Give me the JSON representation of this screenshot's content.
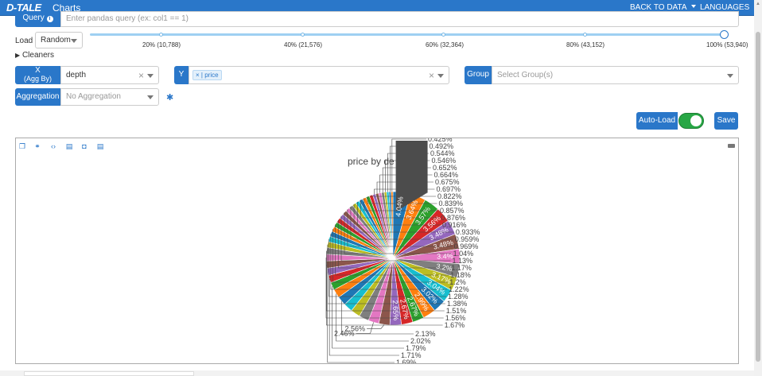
{
  "app": {
    "logo": "D-TALE",
    "title": "Charts"
  },
  "nav": {
    "back_to_data": "BACK TO DATA",
    "languages": "LANGUAGES"
  },
  "query": {
    "label": "Query",
    "info_icon": "info-icon",
    "placeholder": "Enter pandas query (ex: col1 == 1)"
  },
  "load": {
    "label": "Load",
    "value": "Random",
    "ticks": [
      "20% (10,788)",
      "40% (21,576)",
      "60% (32,364)",
      "80% (43,152)",
      "100% (53,940)"
    ]
  },
  "cleaners": {
    "label": "Cleaners"
  },
  "x": {
    "label": "X",
    "sublabel": "(Agg By)",
    "value": "depth"
  },
  "y": {
    "label": "Y",
    "chip": "price"
  },
  "group": {
    "label": "Group",
    "placeholder": "Select Group(s)"
  },
  "aggregation": {
    "label": "Aggregation",
    "placeholder": "No Aggregation",
    "settings_icon": "gear-icon"
  },
  "actions": {
    "autoload": "Auto-Load",
    "save": "Save",
    "autoload_on": true
  },
  "chart_data": {
    "type": "pie",
    "title": "price by de",
    "slices": [
      {
        "label": "4.04%",
        "value": 4.04,
        "color": "#1f77b4"
      },
      {
        "label": "3.64%",
        "value": 3.64,
        "color": "#ff7f0e"
      },
      {
        "label": "3.57%",
        "value": 3.57,
        "color": "#2ca02c"
      },
      {
        "label": "3.56%",
        "value": 3.56,
        "color": "#d62728"
      },
      {
        "label": "3.48%",
        "value": 3.48,
        "color": "#9467bd"
      },
      {
        "label": "3.48%",
        "value": 3.48,
        "color": "#8c564b"
      },
      {
        "label": "3.4%",
        "value": 3.4,
        "color": "#e377c2"
      },
      {
        "label": "3.2%",
        "value": 3.2,
        "color": "#7f7f7f"
      },
      {
        "label": "3.17%",
        "value": 3.17,
        "color": "#bcbd22"
      },
      {
        "label": "3.04%",
        "value": 3.04,
        "color": "#17becf"
      },
      {
        "label": "3.02%",
        "value": 3.02,
        "color": "#1f77b4"
      },
      {
        "label": "2.99%",
        "value": 2.99,
        "color": "#ff7f0e"
      },
      {
        "label": "2.67%",
        "value": 2.67,
        "color": "#2ca02c"
      },
      {
        "label": "2.67%",
        "value": 2.67,
        "color": "#d62728"
      },
      {
        "label": "2.65%",
        "value": 2.65,
        "color": "#9467bd"
      },
      {
        "label": "2.56%",
        "value": 2.56,
        "color": "#8c564b"
      },
      {
        "label": "2.46%",
        "value": 2.46,
        "color": "#e377c2"
      },
      {
        "label": "",
        "value": 2.3,
        "color": "#7f7f7f"
      },
      {
        "label": "",
        "value": 2.2,
        "color": "#bcbd22"
      },
      {
        "label": "",
        "value": 2.1,
        "color": "#17becf"
      },
      {
        "label": "2.13%",
        "value": 2.13,
        "color": "#1f77b4"
      },
      {
        "label": "2.02%",
        "value": 2.02,
        "color": "#ff7f0e"
      },
      {
        "label": "1.79%",
        "value": 1.79,
        "color": "#2ca02c"
      },
      {
        "label": "1.71%",
        "value": 1.71,
        "color": "#d62728"
      },
      {
        "label": "1.69%",
        "value": 1.69,
        "color": "#9467bd"
      },
      {
        "label": "1.67%",
        "value": 1.67,
        "color": "#8c564b"
      },
      {
        "label": "1.56%",
        "value": 1.56,
        "color": "#e377c2"
      },
      {
        "label": "1.51%",
        "value": 1.51,
        "color": "#7f7f7f"
      },
      {
        "label": "1.38%",
        "value": 1.38,
        "color": "#bcbd22"
      },
      {
        "label": "1.28%",
        "value": 1.28,
        "color": "#17becf"
      },
      {
        "label": "1.22%",
        "value": 1.22,
        "color": "#1f77b4"
      },
      {
        "label": "1.2%",
        "value": 1.2,
        "color": "#ff7f0e"
      },
      {
        "label": "1.18%",
        "value": 1.18,
        "color": "#2ca02c"
      },
      {
        "label": "1.17%",
        "value": 1.17,
        "color": "#d62728"
      },
      {
        "label": "1.13%",
        "value": 1.13,
        "color": "#9467bd"
      },
      {
        "label": "1.04%",
        "value": 1.04,
        "color": "#8c564b"
      },
      {
        "label": "0.969%",
        "value": 0.969,
        "color": "#e377c2"
      },
      {
        "label": "0.959%",
        "value": 0.959,
        "color": "#7f7f7f"
      },
      {
        "label": "0.933%",
        "value": 0.933,
        "color": "#bcbd22"
      },
      {
        "label": "0.916%",
        "value": 0.916,
        "color": "#17becf"
      },
      {
        "label": "0.876%",
        "value": 0.876,
        "color": "#1f77b4"
      },
      {
        "label": "0.857%",
        "value": 0.857,
        "color": "#ff7f0e"
      },
      {
        "label": "0.839%",
        "value": 0.839,
        "color": "#2ca02c"
      },
      {
        "label": "0.822%",
        "value": 0.822,
        "color": "#d62728"
      },
      {
        "label": "0.697%",
        "value": 0.697,
        "color": "#9467bd"
      },
      {
        "label": "0.675%",
        "value": 0.675,
        "color": "#8c564b"
      },
      {
        "label": "0.664%",
        "value": 0.664,
        "color": "#e377c2"
      },
      {
        "label": "0.652%",
        "value": 0.652,
        "color": "#7f7f7f"
      },
      {
        "label": "0.546%",
        "value": 0.546,
        "color": "#bcbd22"
      },
      {
        "label": "0.544%",
        "value": 0.544,
        "color": "#17becf"
      },
      {
        "label": "0.492%",
        "value": 0.492,
        "color": "#1f77b4"
      },
      {
        "label": "0.425%",
        "value": 0.425,
        "color": "#ff7f0e"
      }
    ]
  }
}
